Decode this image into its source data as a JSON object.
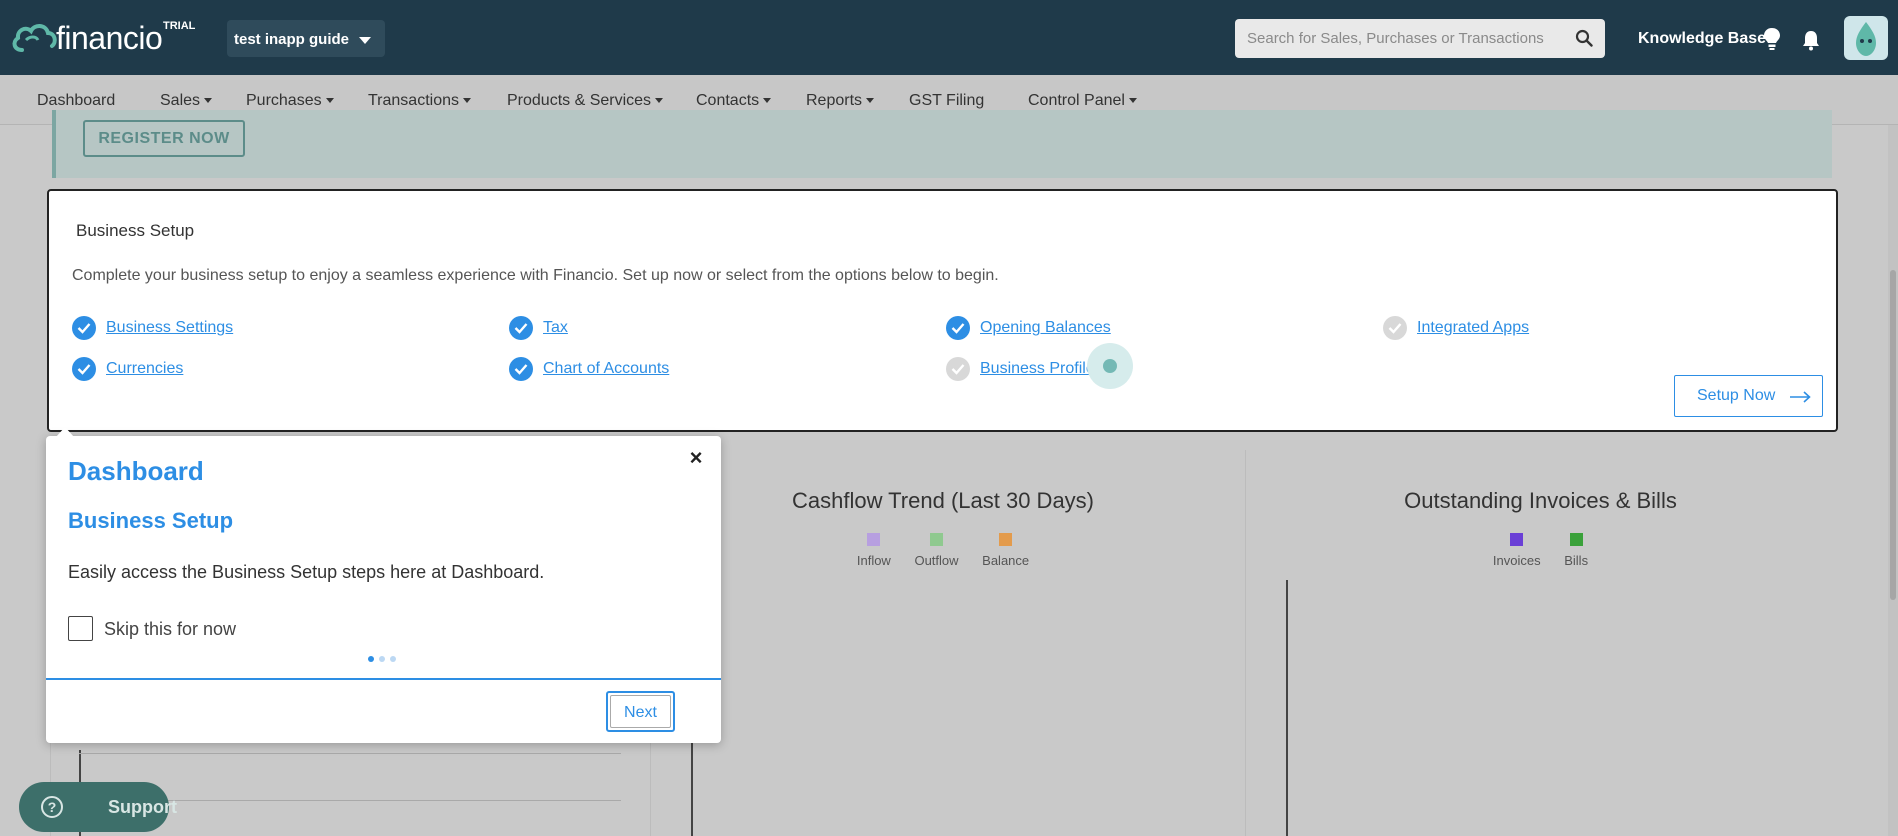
{
  "header": {
    "logo_text": "financio",
    "trial_badge": "TRIAL",
    "org_name": "test inapp guide",
    "search_placeholder": "Search for Sales, Purchases or Transactions",
    "knowledge_base": "Knowledge Base"
  },
  "nav": {
    "items": [
      {
        "label": "Dashboard",
        "has_menu": false
      },
      {
        "label": "Sales",
        "has_menu": true
      },
      {
        "label": "Purchases",
        "has_menu": true
      },
      {
        "label": "Transactions",
        "has_menu": true
      },
      {
        "label": "Products & Services",
        "has_menu": true
      },
      {
        "label": "Contacts",
        "has_menu": true
      },
      {
        "label": "Reports",
        "has_menu": true
      },
      {
        "label": "GST Filing",
        "has_menu": false
      },
      {
        "label": "Control Panel",
        "has_menu": true
      }
    ]
  },
  "register": {
    "button_label": "REGISTER NOW"
  },
  "business_setup": {
    "title": "Business Setup",
    "description": "Complete your business setup to enjoy a seamless experience with Financio. Set up now or select from the options below to begin.",
    "steps": [
      {
        "label": "Business Settings",
        "done": true
      },
      {
        "label": "Currencies",
        "done": true
      },
      {
        "label": "Tax",
        "done": true
      },
      {
        "label": "Chart of Accounts",
        "done": true
      },
      {
        "label": "Opening Balances",
        "done": true
      },
      {
        "label": "Business Profile",
        "done": false
      },
      {
        "label": "Integrated Apps",
        "done": false
      }
    ],
    "setup_button": "Setup Now"
  },
  "charts": {
    "cashflow": {
      "title": "Cashflow Trend (Last 30 Days)",
      "legend": [
        {
          "label": "Inflow",
          "color": "#b79fe0"
        },
        {
          "label": "Outflow",
          "color": "#8fc98f"
        },
        {
          "label": "Balance",
          "color": "#e39b4c"
        }
      ]
    },
    "outstanding": {
      "title": "Outstanding Invoices & Bills",
      "legend": [
        {
          "label": "Invoices",
          "color": "#6a3fd6"
        },
        {
          "label": "Bills",
          "color": "#3aa13a"
        }
      ]
    }
  },
  "guide": {
    "title": "Dashboard",
    "subtitle": "Business Setup",
    "text": "Easily access the Business Setup steps here at Dashboard.",
    "skip_label": "Skip this for now",
    "next_label": "Next",
    "step_current": 1,
    "step_total": 3,
    "close_glyph": "×"
  },
  "support": {
    "label": "Support"
  },
  "colors": {
    "brand": "#1f3a4a",
    "accent": "#2d8ee4",
    "support": "#3d6f6a"
  }
}
